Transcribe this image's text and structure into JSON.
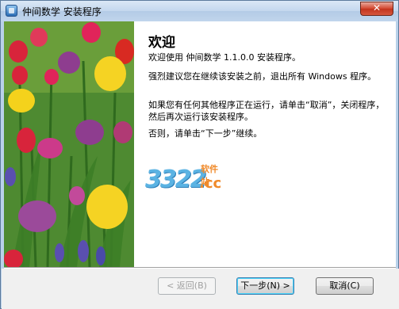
{
  "window": {
    "title": "仲间数学 安装程序",
    "close_glyph": "✕"
  },
  "welcome": {
    "heading": "欢迎",
    "paragraphs": [
      "欢迎使用 仲间数学 1.1.0.0 安装程序。",
      "强烈建议您在继续该安装之前，退出所有 Windows 程序。",
      "如果您有任何其他程序正在运行，请单击“取消”，关闭程序，然后再次运行该安装程序。",
      "否则，请单击“下一步”继续。"
    ]
  },
  "watermark": {
    "number": "3322",
    "site": "软件站",
    "suffix": ".cc"
  },
  "buttons": {
    "back": "< 返回(B)",
    "next": "下一步(N) >",
    "cancel": "取消(C)"
  },
  "icons": {
    "app": "installer-icon",
    "close": "close-icon"
  },
  "colors": {
    "title_bar": "#c3d7ee",
    "close_button": "#d2452e",
    "footer": "#f0f0f0",
    "watermark_blue": "#5bb3e3",
    "watermark_orange": "#f08a2a"
  }
}
